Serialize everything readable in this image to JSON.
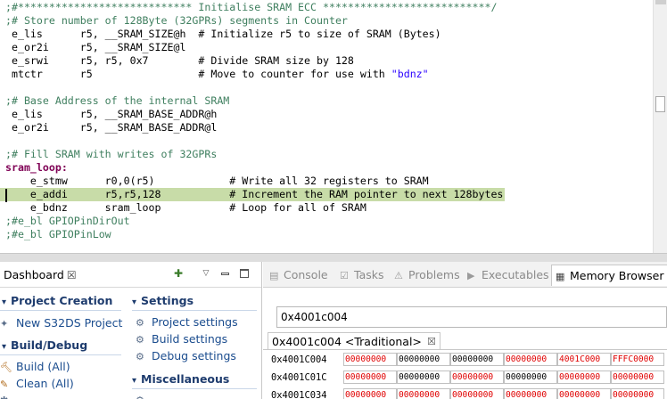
{
  "editor": {
    "lines": [
      {
        "text": ";#**************************** Initialise SRAM ECC ***************************/",
        "style": "comment",
        "hl": false
      },
      {
        "text": ";# Store number of 128Byte (32GPRs) segments in Counter",
        "style": "comment",
        "hl": false
      },
      {
        "text": " e_lis      r5, __SRAM_SIZE@h  # Initialize r5 to size of SRAM (Bytes)",
        "style": "plain",
        "hl": false
      },
      {
        "text": " e_or2i     r5, __SRAM_SIZE@l",
        "style": "plain",
        "hl": false
      },
      {
        "text": " e_srwi     r5, r5, 0x7        # Divide SRAM size by 128",
        "style": "plain",
        "hl": false
      },
      {
        "text": " mtctr      r5                 # Move to counter for use with ",
        "style": "plain",
        "hl": false,
        "str": "\"bdnz\""
      },
      {
        "text": "",
        "style": "plain",
        "hl": false
      },
      {
        "text": ";# Base Address of the internal SRAM",
        "style": "comment",
        "hl": false
      },
      {
        "text": " e_lis      r5, __SRAM_BASE_ADDR@h",
        "style": "plain",
        "hl": false
      },
      {
        "text": " e_or2i     r5, __SRAM_BASE_ADDR@l",
        "style": "plain",
        "hl": false
      },
      {
        "text": "",
        "style": "plain",
        "hl": false
      },
      {
        "text": ";# Fill SRAM with writes of 32GPRs",
        "style": "comment",
        "hl": false
      },
      {
        "text": "sram_loop:",
        "style": "label",
        "hl": false
      },
      {
        "text": "    e_stmw      r0,0(r5)            # Write all 32 registers to SRAM",
        "style": "plain",
        "hl": false
      },
      {
        "text": "    e_addi      r5,r5,128           # Increment the RAM pointer to next 128bytes",
        "style": "plain",
        "hl": true
      },
      {
        "text": "    e_bdnz      sram_loop           # Loop for all of SRAM",
        "style": "plain",
        "hl": false
      },
      {
        "text": ";#e_bl GPIOPinDirOut",
        "style": "comment",
        "hl": false
      },
      {
        "text": ";#e_bl GPIOPinLow",
        "style": "comment",
        "hl": false
      }
    ]
  },
  "dashboard": {
    "tab_label": "Dashboard",
    "close_glyph": "☒",
    "sections": [
      {
        "title": "Project Creation",
        "links": [
          {
            "label": "New S32DS Project",
            "icon": "new-project-icon"
          }
        ]
      },
      {
        "title": "Settings",
        "links": [
          {
            "label": "Project settings",
            "icon": "project-settings-icon"
          },
          {
            "label": "Build settings",
            "icon": "build-settings-icon"
          },
          {
            "label": "Debug settings",
            "icon": "debug-settings-icon"
          }
        ]
      },
      {
        "title": "Build/Debug",
        "links": [
          {
            "label": "Build  (All)",
            "icon": "hammer-icon"
          },
          {
            "label": "Clean  (All)",
            "icon": "clean-icon"
          }
        ]
      },
      {
        "title": "Miscellaneous",
        "links": []
      }
    ]
  },
  "views": {
    "tabs": [
      {
        "label": "Console",
        "icon": "console-icon",
        "active": false
      },
      {
        "label": "Tasks",
        "icon": "tasks-icon",
        "active": false
      },
      {
        "label": "Problems",
        "icon": "problems-icon",
        "active": false
      },
      {
        "label": "Executables",
        "icon": "executables-icon",
        "active": false
      },
      {
        "label": "Memory Browser",
        "icon": "memory-icon",
        "active": true
      }
    ]
  },
  "memory": {
    "address_input": "0x4001c004",
    "rendering_tab": "0x4001c004 <Traditional>",
    "rendering_close": "☒",
    "rows": [
      {
        "address": "0x4001C004",
        "cells": [
          {
            "v": "00000000",
            "changed": true
          },
          {
            "v": "00000000",
            "changed": false
          },
          {
            "v": "00000000",
            "changed": false
          },
          {
            "v": "00000000",
            "changed": true
          },
          {
            "v": "4001C000",
            "changed": true
          },
          {
            "v": "FFFC0000",
            "changed": true
          }
        ]
      },
      {
        "address": "0x4001C01C",
        "cells": [
          {
            "v": "00000000",
            "changed": true
          },
          {
            "v": "00000000",
            "changed": false
          },
          {
            "v": "00000000",
            "changed": true
          },
          {
            "v": "00000000",
            "changed": false
          },
          {
            "v": "00000000",
            "changed": true
          },
          {
            "v": "00000000",
            "changed": true
          }
        ]
      },
      {
        "address": "0x4001C034",
        "cells": [
          {
            "v": "00000000",
            "changed": true
          },
          {
            "v": "00000000",
            "changed": true
          },
          {
            "v": "00000000",
            "changed": true
          },
          {
            "v": "00000000",
            "changed": true
          },
          {
            "v": "00000000",
            "changed": true
          },
          {
            "v": "00000000",
            "changed": true
          }
        ]
      }
    ]
  }
}
